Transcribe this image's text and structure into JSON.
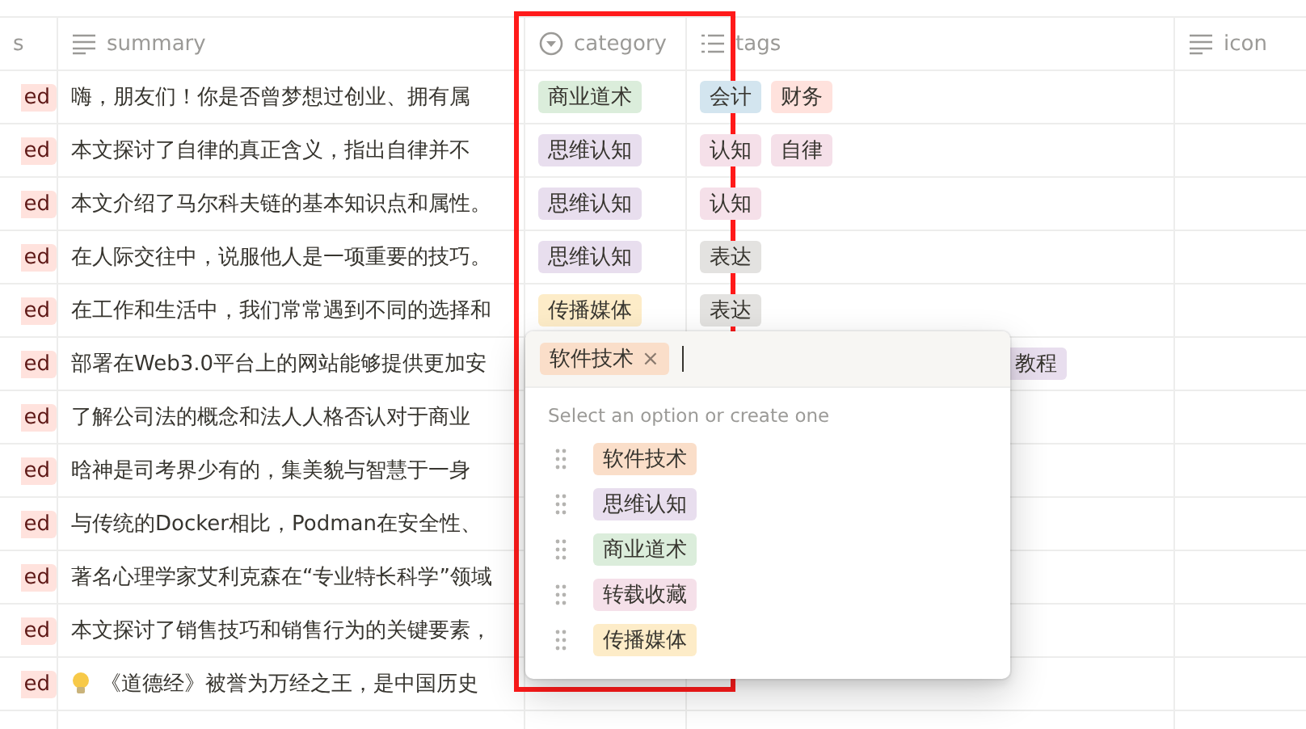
{
  "columns": [
    {
      "label": "s"
    },
    {
      "label": "summary"
    },
    {
      "label": "category"
    },
    {
      "label": "tags"
    },
    {
      "label": "icon"
    }
  ],
  "rows": [
    {
      "status": "ed",
      "has_icon": false,
      "covered": false,
      "summary": "嗨，朋友们！你是否曾梦想过创业、拥有属",
      "category": {
        "label": "商业道术",
        "color": "#dbeddb"
      },
      "tags": [
        {
          "label": "会计",
          "color": "#d3e5ef"
        },
        {
          "label": "财务",
          "color": "#ffe2dd"
        }
      ]
    },
    {
      "status": "ed",
      "has_icon": false,
      "covered": false,
      "summary": "本文探讨了自律的真正含义，指出自律并不",
      "category": {
        "label": "思维认知",
        "color": "#e8deee"
      },
      "tags": [
        {
          "label": "认知",
          "color": "#f5e0e9"
        },
        {
          "label": "自律",
          "color": "#f5e0e9"
        }
      ]
    },
    {
      "status": "ed",
      "has_icon": false,
      "covered": false,
      "summary": "本文介绍了马尔科夫链的基本知识点和属性。",
      "category": {
        "label": "思维认知",
        "color": "#e8deee"
      },
      "tags": [
        {
          "label": "认知",
          "color": "#f5e0e9"
        }
      ]
    },
    {
      "status": "ed",
      "has_icon": false,
      "covered": false,
      "summary": "在人际交往中，说服他人是一项重要的技巧。",
      "category": {
        "label": "思维认知",
        "color": "#e8deee"
      },
      "tags": [
        {
          "label": "表达",
          "color": "#e3e2e0"
        }
      ]
    },
    {
      "status": "ed",
      "has_icon": false,
      "covered": false,
      "summary": "在工作和生活中，我们常常遇到不同的选择和",
      "category": {
        "label": "传播媒体",
        "color": "#fdecc8"
      },
      "tags": [
        {
          "label": "表达",
          "color": "#e3e2e0"
        }
      ]
    },
    {
      "status": "ed",
      "has_icon": false,
      "covered": true,
      "summary": "部署在Web3.0平台上的网站能够提供更加安",
      "tags": [
        {
          "label": "教程",
          "color": "#e8deee"
        }
      ]
    },
    {
      "status": "ed",
      "has_icon": false,
      "summary": "了解公司法的概念和法人人格否认对于商业"
    },
    {
      "status": "ed",
      "has_icon": false,
      "summary": "晗神是司考界少有的，集美貌与智慧于一身"
    },
    {
      "status": "ed",
      "has_icon": false,
      "summary": "与传统的Docker相比，Podman在安全性、"
    },
    {
      "status": "ed",
      "has_icon": false,
      "summary": "著名心理学家艾利克森在“专业特长科学”领域"
    },
    {
      "status": "ed",
      "has_icon": false,
      "summary": "本文探讨了销售技巧和销售行为的关键要素，"
    },
    {
      "status": "ed",
      "has_icon": true,
      "summary": "《道德经》被誉为万经之王，是中国历史"
    }
  ],
  "popup": {
    "selected": {
      "label": "软件技术",
      "color": "#fadec9",
      "remove": "×"
    },
    "hint": "Select an option or create one",
    "options": [
      {
        "label": "软件技术",
        "color": "#fadec9"
      },
      {
        "label": "思维认知",
        "color": "#e8deee"
      },
      {
        "label": "商业道术",
        "color": "#dbeddb"
      },
      {
        "label": "转载收藏",
        "color": "#f5e0e9"
      },
      {
        "label": "传播媒体",
        "color": "#fdecc8"
      }
    ]
  },
  "highlight": {
    "color": "#ff1a1a"
  }
}
